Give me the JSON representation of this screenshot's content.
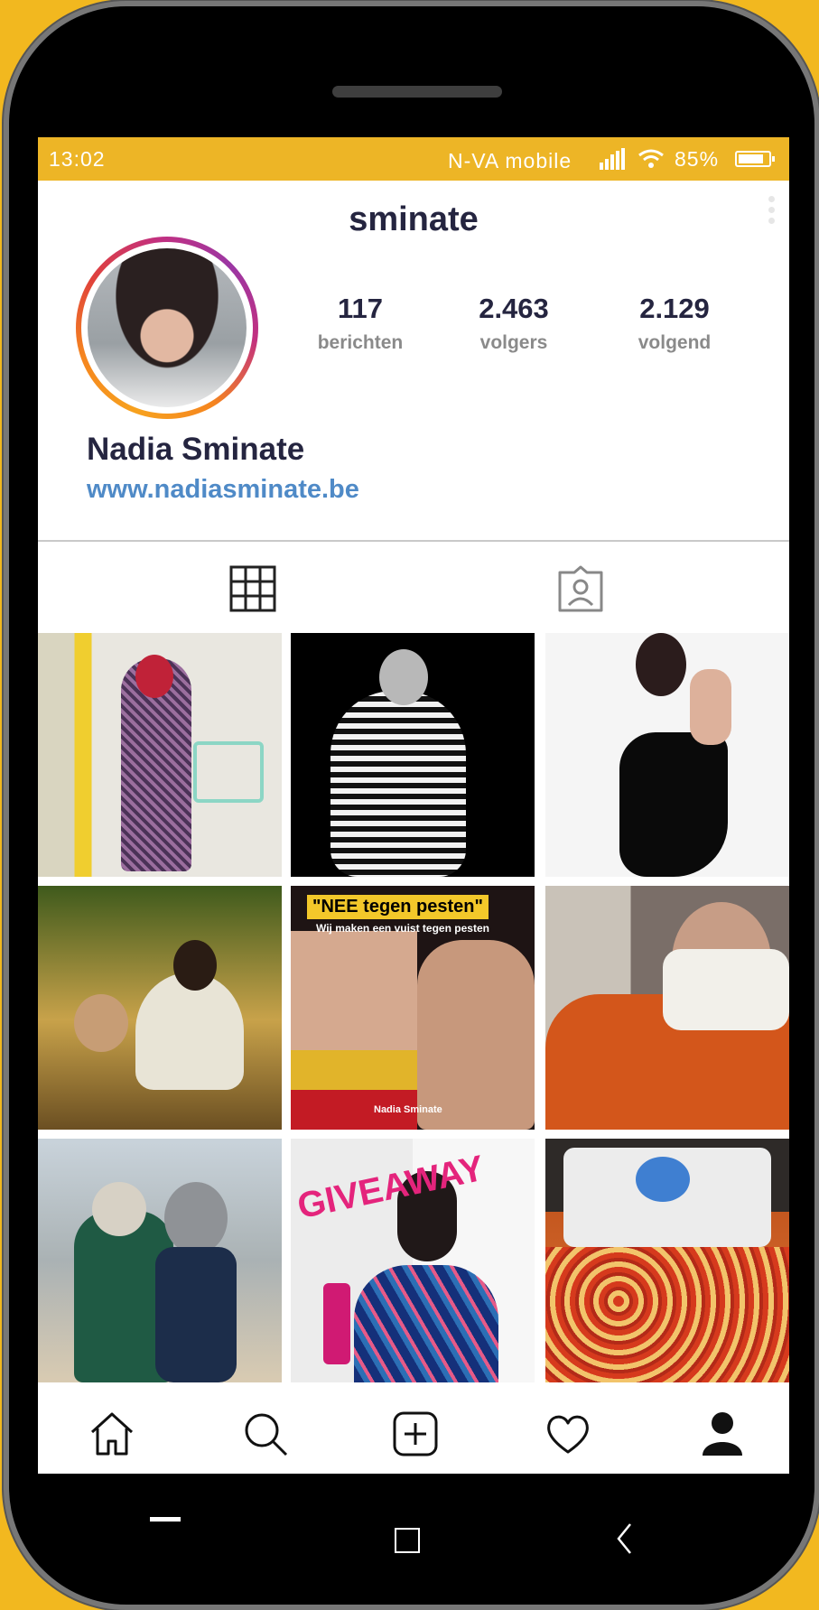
{
  "status_bar": {
    "time": "13:02",
    "carrier": "N-VA mobile",
    "battery": "85%",
    "battery_level": 0.85
  },
  "profile": {
    "username": "sminate",
    "full_name": "Nadia Sminate",
    "website": "www.nadiasminate.be",
    "stats": [
      {
        "value": "117",
        "label": "berichten"
      },
      {
        "value": "2.463",
        "label": "volgers"
      },
      {
        "value": "2.129",
        "label": "volgend"
      }
    ]
  },
  "tabs": [
    {
      "icon": "grid-icon",
      "active": true
    },
    {
      "icon": "tagged-user-icon",
      "active": false
    }
  ],
  "posts": [
    {
      "id": 1,
      "caption": ""
    },
    {
      "id": 2,
      "caption": ""
    },
    {
      "id": 3,
      "caption": ""
    },
    {
      "id": 4,
      "caption": ""
    },
    {
      "id": 5,
      "caption": "\"NEE tegen pesten\"",
      "subcaption": "Wij maken een vuist tegen pesten",
      "footer": "Nadia Sminate"
    },
    {
      "id": 6,
      "caption": ""
    },
    {
      "id": 7,
      "caption": ""
    },
    {
      "id": 8,
      "caption": "GIVEAWAY"
    },
    {
      "id": 9,
      "caption": ""
    }
  ],
  "bottom_nav": [
    "home-icon",
    "search-icon",
    "add-post-icon",
    "heart-icon",
    "profile-icon"
  ],
  "system_nav": [
    "recent-apps-icon",
    "home-square-icon",
    "back-icon"
  ],
  "colors": {
    "background": "#f2b81f",
    "status_bar": "#edb526",
    "link": "#4f8ac7",
    "text": "#252540"
  }
}
